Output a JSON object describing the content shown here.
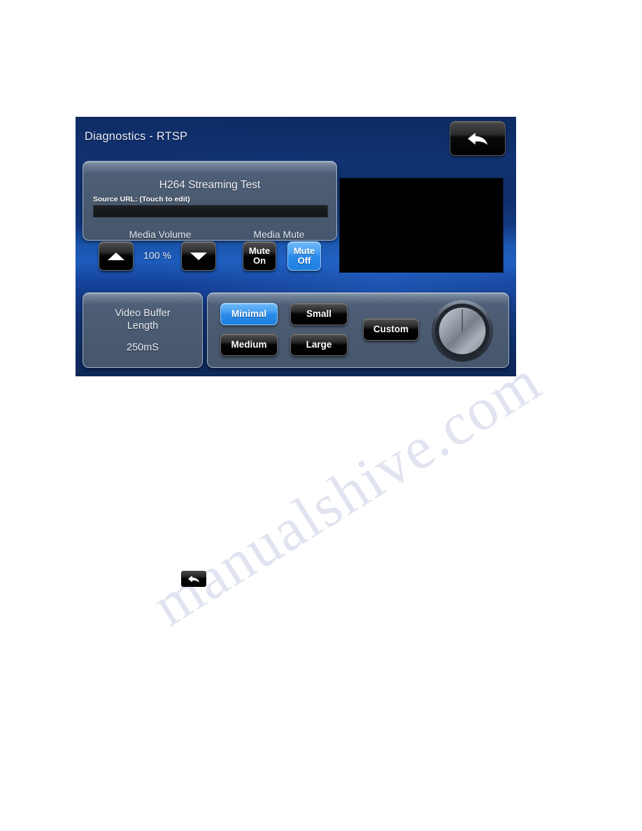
{
  "screen": {
    "header": {
      "title": "Diagnostics - RTSP",
      "back_button_icon": "back-arrow-icon",
      "back_button_label": ""
    },
    "streaming_panel": {
      "title": "H264 Streaming Test",
      "url_label": "Source URL: (Touch to edit)",
      "url_value": "",
      "url_placeholder": "",
      "volume": {
        "label": "Media Volume",
        "up_icon": "triangle-up-icon",
        "down_icon": "triangle-down-icon",
        "value": "100 %"
      },
      "mute": {
        "label": "Media Mute",
        "on_label": "Mute\nOn",
        "on_line1": "Mute",
        "on_line2": "On",
        "off_line1": "Mute",
        "off_line2": "Off",
        "selected": "Mute Off"
      }
    },
    "video_preview": {
      "name": "video-preview-window",
      "content": ""
    },
    "buffer_length_panel": {
      "title_line1": "Video Buffer",
      "title_line2": "Length",
      "value": "250mS"
    },
    "presets_panel": {
      "buttons": [
        {
          "label": "Minimal",
          "selected": true
        },
        {
          "label": "Small",
          "selected": false
        },
        {
          "label": "Medium",
          "selected": false
        },
        {
          "label": "Large",
          "selected": false
        }
      ],
      "custom_label": "Custom",
      "knob_icon": "rotary-knob-icon"
    },
    "colors": {
      "accent_blue": "#2a8bea",
      "panel_slate": "#49596f",
      "screen_navy": "#0f2f6d",
      "button_black": "#000000"
    }
  },
  "document": {
    "inline_back_icon": "back-arrow-icon",
    "watermark": "manualshive.com"
  }
}
